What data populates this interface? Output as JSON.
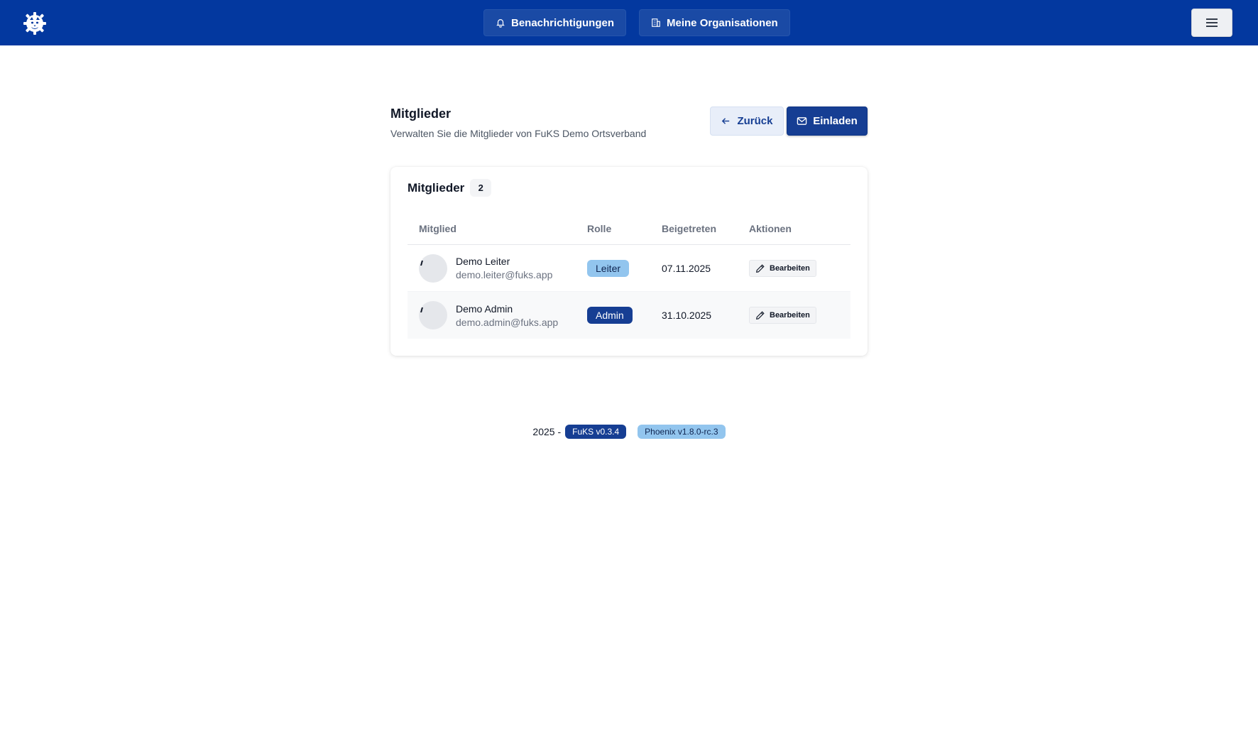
{
  "colors": {
    "navbar": "#03389f",
    "primary": "#163e93",
    "light_badge": "#92c5ee"
  },
  "navbar": {
    "logo_icon": "gear-cat-logo-icon",
    "notifications_label": "Benachrichtigungen",
    "organizations_label": "Meine Organisationen",
    "menu_icon": "hamburger-menu-icon"
  },
  "header": {
    "title": "Mitglieder",
    "subtitle": "Verwalten Sie die Mitglieder von FuKS Demo Ortsverband",
    "back_label": "Zurück",
    "invite_label": "Einladen"
  },
  "members_card": {
    "title": "Mitglieder",
    "count": "2",
    "columns": [
      "Mitglied",
      "Rolle",
      "Beigetreten",
      "Aktionen"
    ],
    "rows": [
      {
        "name": "Demo Leiter",
        "email": "demo.leiter@fuks.app",
        "role": "Leiter",
        "joined": "07.11.2025",
        "action": "Bearbeiten"
      },
      {
        "name": "Demo Admin",
        "email": "demo.admin@fuks.app",
        "role": "Admin",
        "joined": "31.10.2025",
        "action": "Bearbeiten"
      }
    ]
  },
  "footer": {
    "year": "2025 -",
    "fuks_version": "FuKS v0.3.4",
    "phoenix_version": "Phoenix v1.8.0-rc.3"
  }
}
